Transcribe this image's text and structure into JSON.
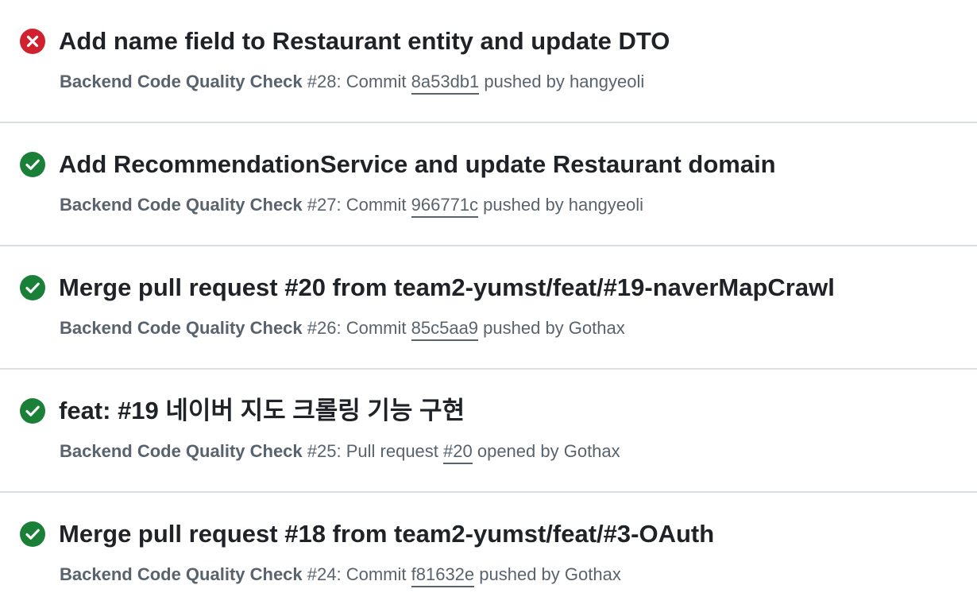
{
  "colors": {
    "failure": "#cf222e",
    "success": "#1a7f37",
    "title": "#1f2328",
    "meta": "#59636e",
    "divider": "#d8dee4"
  },
  "runs": [
    {
      "status": "failure",
      "status_icon": "x-circle-fill-icon",
      "title": "Add name field to Restaurant entity and update DTO",
      "workflow": "Backend Code Quality Check",
      "run_number": "#28",
      "event_text": ": Commit ",
      "link_text": "8a53db1",
      "actor_text": " pushed by hangyeoli"
    },
    {
      "status": "success",
      "status_icon": "check-circle-fill-icon",
      "title": "Add RecommendationService and update Restaurant domain",
      "workflow": "Backend Code Quality Check",
      "run_number": "#27",
      "event_text": ": Commit ",
      "link_text": "966771c",
      "actor_text": " pushed by hangyeoli"
    },
    {
      "status": "success",
      "status_icon": "check-circle-fill-icon",
      "title": "Merge pull request #20 from team2-yumst/feat/#19-naverMapCrawl",
      "workflow": "Backend Code Quality Check",
      "run_number": "#26",
      "event_text": ": Commit ",
      "link_text": "85c5aa9",
      "actor_text": " pushed by Gothax"
    },
    {
      "status": "success",
      "status_icon": "check-circle-fill-icon",
      "title": "feat: #19 네이버 지도 크롤링 기능 구현",
      "workflow": "Backend Code Quality Check",
      "run_number": "#25",
      "event_text": ": Pull request ",
      "link_text": "#20",
      "actor_text": " opened by Gothax"
    },
    {
      "status": "success",
      "status_icon": "check-circle-fill-icon",
      "title": "Merge pull request #18 from team2-yumst/feat/#3-OAuth",
      "workflow": "Backend Code Quality Check",
      "run_number": "#24",
      "event_text": ": Commit ",
      "link_text": "f81632e",
      "actor_text": " pushed by Gothax"
    }
  ]
}
